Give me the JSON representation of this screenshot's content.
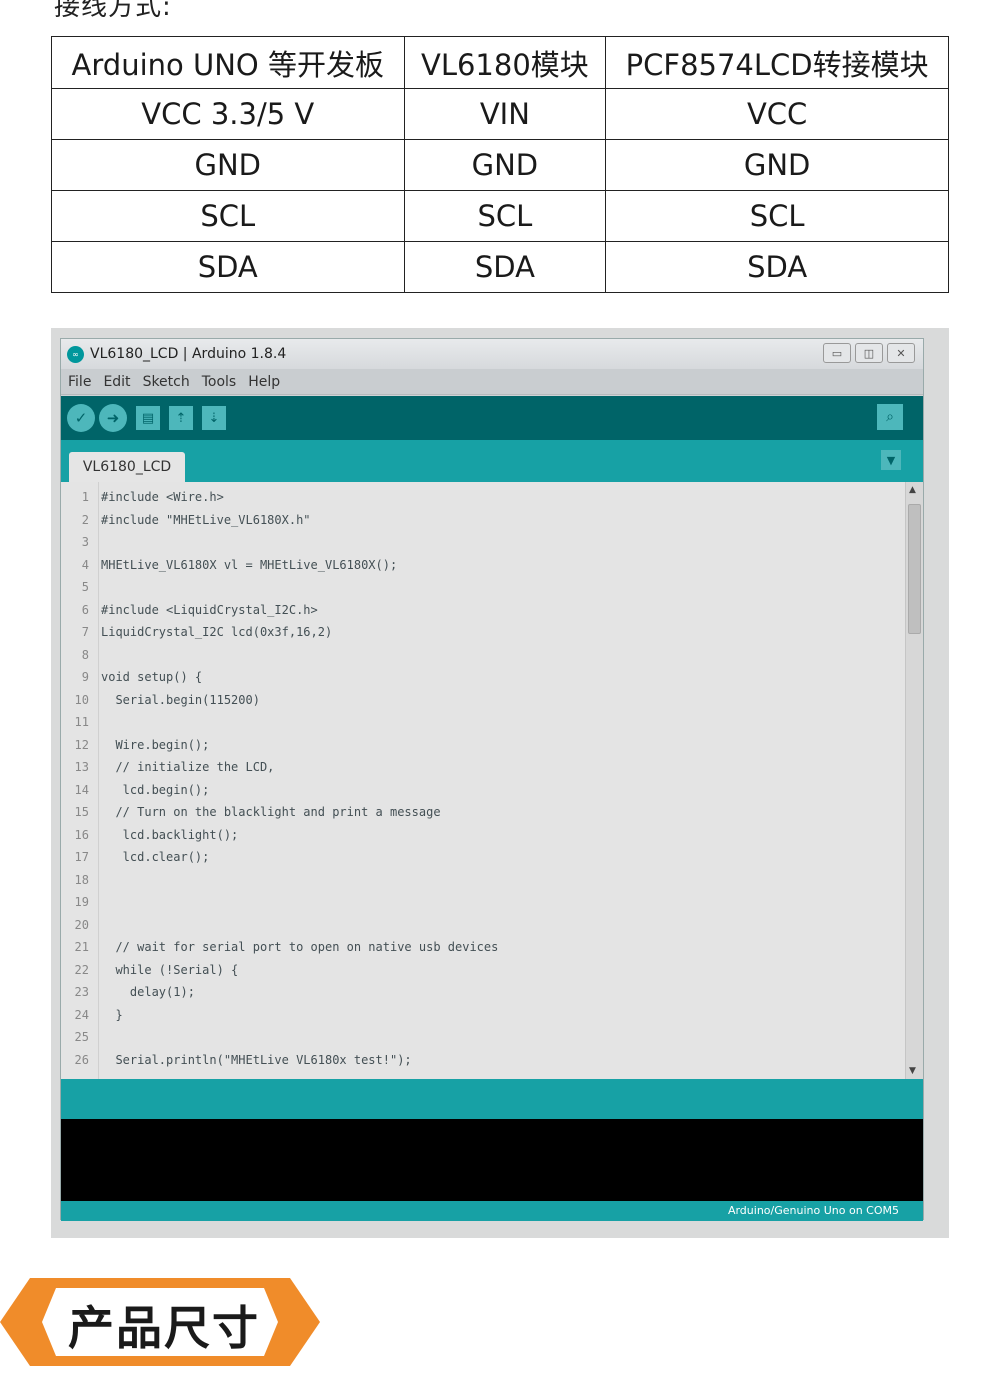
{
  "top_text": "接线方式:",
  "pin_table": {
    "headers": [
      "Arduino UNO 等开发板",
      "VL6180模块",
      "PCF8574LCD转接模块"
    ],
    "rows": [
      [
        "VCC 3.3/5 V",
        "VIN",
        "VCC"
      ],
      [
        "GND",
        "GND",
        "GND"
      ],
      [
        "SCL",
        "SCL",
        "SCL"
      ],
      [
        "SDA",
        "SDA",
        "SDA"
      ]
    ]
  },
  "ide": {
    "title": "VL6180_LCD | Arduino 1.8.4",
    "logo": "∞",
    "menu": [
      "File",
      "Edit",
      "Sketch",
      "Tools",
      "Help"
    ],
    "tab_name": "VL6180_LCD",
    "code_lines": [
      {
        "n": "1",
        "text": "#include <Wire.h>"
      },
      {
        "n": "2",
        "text": "#include \"MHEtLive_VL6180X.h\""
      },
      {
        "n": "3",
        "text": ""
      },
      {
        "n": "4",
        "text": "MHEtLive_VL6180X vl = MHEtLive_VL6180X();"
      },
      {
        "n": "5",
        "text": ""
      },
      {
        "n": "6",
        "text": "#include <LiquidCrystal_I2C.h>"
      },
      {
        "n": "7",
        "text": "LiquidCrystal_I2C lcd(0x3f,16,2)"
      },
      {
        "n": "8",
        "text": ""
      },
      {
        "n": "9",
        "text": "void setup() {"
      },
      {
        "n": "10",
        "text": "  Serial.begin(115200)"
      },
      {
        "n": "11",
        "text": ""
      },
      {
        "n": "12",
        "text": "  Wire.begin();"
      },
      {
        "n": "13",
        "text": "  // initialize the LCD,"
      },
      {
        "n": "14",
        "text": "   lcd.begin();"
      },
      {
        "n": "15",
        "text": "  // Turn on the blacklight and print a message"
      },
      {
        "n": "16",
        "text": "   lcd.backlight();"
      },
      {
        "n": "17",
        "text": "   lcd.clear();"
      },
      {
        "n": "18",
        "text": ""
      },
      {
        "n": "19",
        "text": ""
      },
      {
        "n": "20",
        "text": ""
      },
      {
        "n": "21",
        "text": "  // wait for serial port to open on native usb devices"
      },
      {
        "n": "22",
        "text": "  while (!Serial) {"
      },
      {
        "n": "23",
        "text": "    delay(1);"
      },
      {
        "n": "24",
        "text": "  }"
      },
      {
        "n": "25",
        "text": ""
      },
      {
        "n": "26",
        "text": "  Serial.println(\"MHEtLive VL6180x test!\");"
      }
    ],
    "board_info": "Arduino/Genuino Uno on COM5"
  },
  "banner": {
    "text": "产品尺寸",
    "color": "#f08c2a"
  },
  "colors": {
    "arduino_teal_dark": "#006468",
    "arduino_teal": "#17a1a5",
    "arduino_teal_light": "#4db7bb"
  }
}
